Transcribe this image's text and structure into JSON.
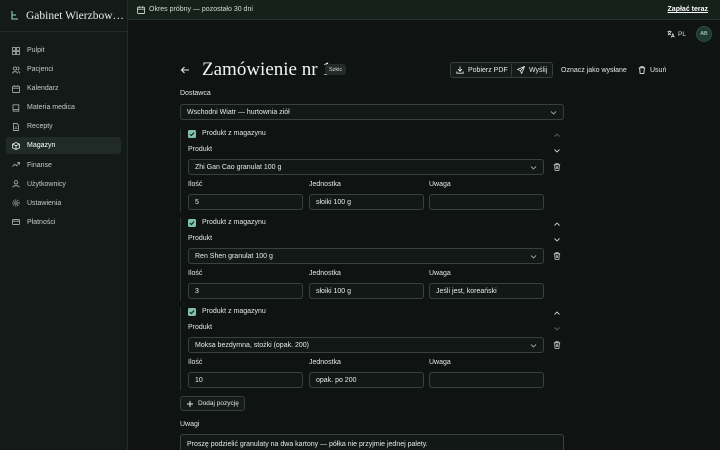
{
  "app": {
    "name": "Gabinet Wierzbow…",
    "colors": {
      "accent": "#7fc3a5",
      "background": "#0f1412",
      "sidebar": "#131a17"
    }
  },
  "sidebar": {
    "items": [
      {
        "label": "Pulpit",
        "icon": "dashboard-icon",
        "active": false
      },
      {
        "label": "Pacjenci",
        "icon": "users-icon",
        "active": false
      },
      {
        "label": "Kalendarz",
        "icon": "calendar-icon",
        "active": false
      },
      {
        "label": "Materia medica",
        "icon": "book-icon",
        "active": false
      },
      {
        "label": "Recepty",
        "icon": "prescription-icon",
        "active": false
      },
      {
        "label": "Magazyn",
        "icon": "package-icon",
        "active": true
      },
      {
        "label": "Finanse",
        "icon": "finance-icon",
        "active": false
      },
      {
        "label": "Użytkownicy",
        "icon": "user-group-icon",
        "active": false
      },
      {
        "label": "Ustawienia",
        "icon": "gear-icon",
        "active": false
      },
      {
        "label": "Płatności",
        "icon": "card-icon",
        "active": false
      }
    ]
  },
  "banner": {
    "text": "Okres próbny — pozostało 30 dni",
    "cta": "Zapłać teraz"
  },
  "topbar": {
    "lang": "PL",
    "avatar": "AB"
  },
  "order": {
    "title": "Zamówienie nr 1",
    "status": "Szkic",
    "actions": {
      "pdf": "Pobierz PDF",
      "send": "Wyślij",
      "mark_sent": "Oznacz jako wysłane",
      "delete": "Usuń"
    },
    "supplier_label": "Dostawca",
    "supplier_value": "Wschodni Wiatr — hurtownia ziół",
    "labels": {
      "from_stock": "Produkt z magazynu",
      "product": "Produkt",
      "qty": "Ilość",
      "unit": "Jednostka",
      "note": "Uwaga"
    },
    "lines": [
      {
        "product": "Zhi Gan Cao granulat 100 g",
        "qty": "5",
        "unit": "słoiki 100 g",
        "note": "",
        "checked": true
      },
      {
        "product": "Ren Shen granulat 100 g",
        "qty": "3",
        "unit": "słoiki 100 g",
        "note": "Jeśli jest, koreański",
        "checked": true
      },
      {
        "product": "Moksa bezdymna, stożki (opak. 200)",
        "qty": "10",
        "unit": "opak. po 200",
        "note": "",
        "checked": true
      }
    ],
    "add_line": "Dodaj pozycję",
    "notes_label": "Uwagi",
    "notes_value": "Proszę podzielić granulaty na dwa kartony — półka nie przyjmie jednej palety."
  }
}
